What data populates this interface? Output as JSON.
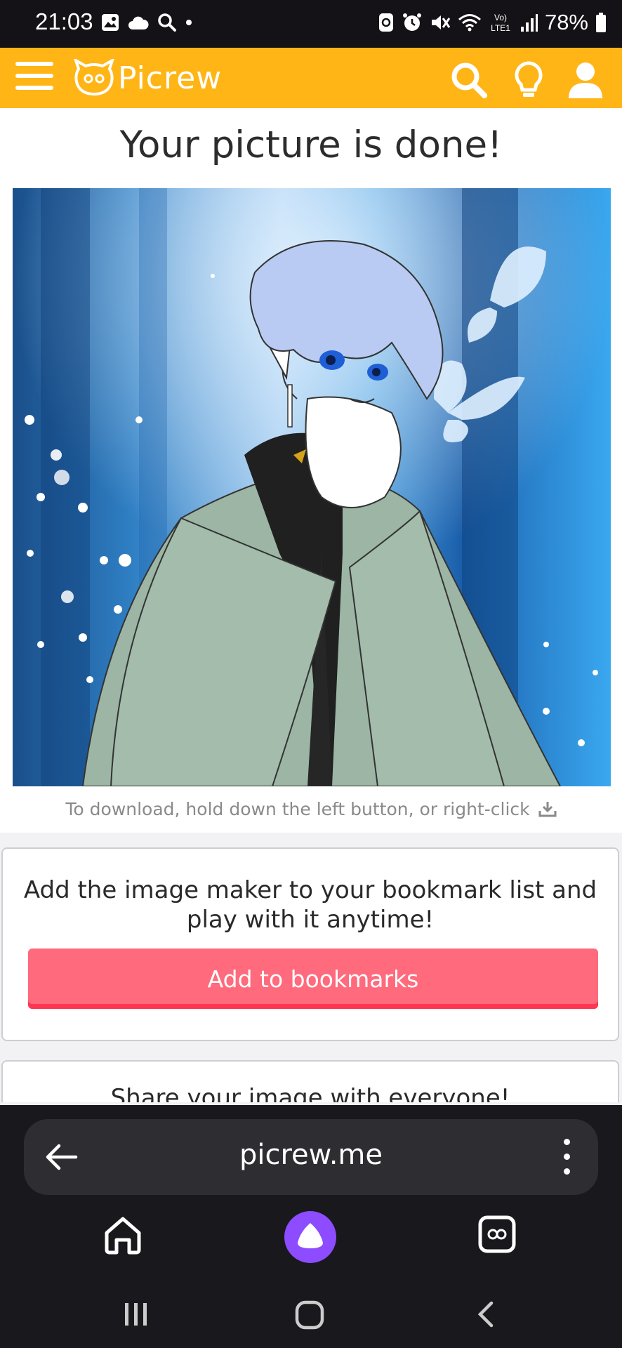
{
  "status_bar": {
    "time": "21:03",
    "battery": "78%",
    "left_icons": [
      "gallery-icon",
      "cloud-icon",
      "search-icon",
      "dot-icon"
    ],
    "right_icons": [
      "nfc-icon",
      "alarm-icon",
      "mute-icon",
      "wifi-icon",
      "volte-icon",
      "signal-icon",
      "battery-icon"
    ],
    "volte_label": "Vo) LTE1"
  },
  "header": {
    "logo_text": "Picrew",
    "icons": [
      "menu-icon",
      "search-icon",
      "lightbulb-icon",
      "user-icon"
    ],
    "accent_color": "#ffb515"
  },
  "main": {
    "title": "Your picture is done!",
    "download_hint": "To download, hold down the left button, or right-click",
    "picture_alt": "Generated character illustration"
  },
  "bookmark_card": {
    "text": "Add the image maker to your bookmark list and play with it anytime!",
    "button_label": "Add to bookmarks",
    "button_color": "#ff6a7d"
  },
  "share_card": {
    "text": "Share your image with everyone!"
  },
  "browser": {
    "url": "picrew.me",
    "icons": [
      "back-arrow-icon",
      "more-vert-icon",
      "home-icon",
      "assistant-icon",
      "tabs-icon"
    ]
  },
  "system_nav": {
    "icons": [
      "recents-icon",
      "home-circle-icon",
      "back-chevron-icon"
    ]
  }
}
